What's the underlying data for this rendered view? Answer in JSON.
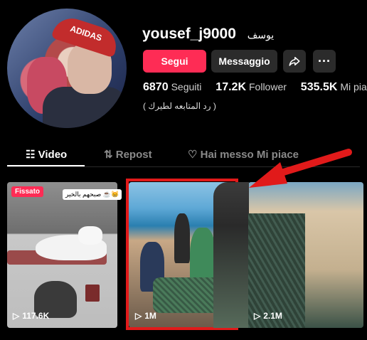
{
  "profile": {
    "username": "yousef_j9000",
    "display_name": "يوسف",
    "bio": "( رد المتابعه لطيرك )",
    "cap_text": "ADIDAS"
  },
  "buttons": {
    "follow": "Segui",
    "message": "Messaggio",
    "share_icon": "share-icon",
    "more": "···"
  },
  "stats": [
    {
      "value": "6870",
      "label": "Seguiti"
    },
    {
      "value": "17.2K",
      "label": "Follower"
    },
    {
      "value": "535.5K",
      "label": "Mi piace"
    }
  ],
  "tabs": [
    {
      "label": "Video",
      "icon": "grid-icon",
      "active": true
    },
    {
      "label": "Repost",
      "icon": "repost-icon",
      "active": false
    },
    {
      "label": "Hai messo Mi piace",
      "icon": "heart-icon",
      "active": false
    }
  ],
  "videos": [
    {
      "badge": "Fissato",
      "caption": "صبحهم بالخير ☕😸",
      "views": "117.6K"
    },
    {
      "views": "1M"
    },
    {
      "views": "2.1M"
    }
  ],
  "colors": {
    "accent": "#fe2c55",
    "highlight": "#e11a1a",
    "background": "#000000",
    "button_dark": "#2b2b2b"
  }
}
